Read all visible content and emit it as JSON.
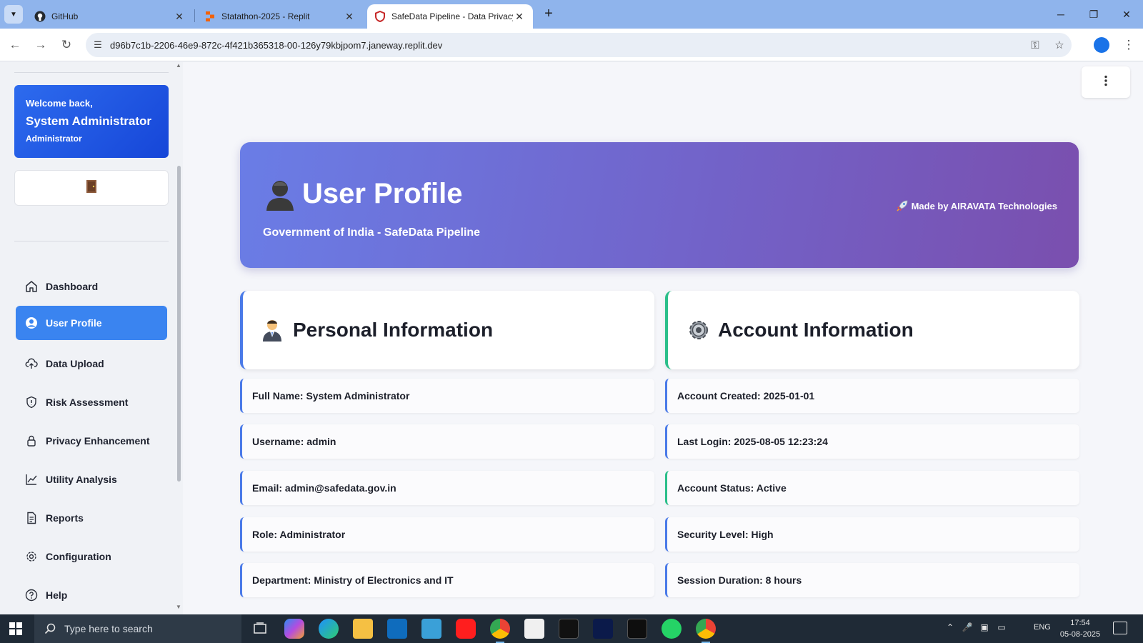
{
  "browser": {
    "tabs": [
      {
        "label": "GitHub",
        "active": false
      },
      {
        "label": "Statathon-2025 - Replit",
        "active": false
      },
      {
        "label": "SafeData Pipeline - Data Privacy",
        "active": true
      }
    ],
    "url": "d96b7c1b-2206-46e9-872c-4f421b365318-00-126y79kbjpom7.janeway.replit.dev"
  },
  "sidebar": {
    "welcome_line": "Welcome back,",
    "user_name": "System Administrator",
    "user_role": "Administrator",
    "logout_icon": "door-icon",
    "items": [
      {
        "label": "Dashboard",
        "icon": "home-icon",
        "active": false
      },
      {
        "label": "User Profile",
        "icon": "user-circle-icon",
        "active": true
      },
      {
        "label": "Data Upload",
        "icon": "cloud-upload-icon",
        "active": false
      },
      {
        "label": "Risk Assessment",
        "icon": "shield-icon",
        "active": false
      },
      {
        "label": "Privacy Enhancement",
        "icon": "lock-icon",
        "active": false
      },
      {
        "label": "Utility Analysis",
        "icon": "line-chart-icon",
        "active": false
      },
      {
        "label": "Reports",
        "icon": "document-icon",
        "active": false
      },
      {
        "label": "Configuration",
        "icon": "gear-icon",
        "active": false
      },
      {
        "label": "Help",
        "icon": "question-icon",
        "active": false
      }
    ]
  },
  "hero": {
    "title": "User Profile",
    "subtitle": "Government of India - SafeData Pipeline",
    "made_by": "Made by AIRAVATA Technologies"
  },
  "personal": {
    "title": "Personal Information",
    "rows": [
      "Full Name: System Administrator",
      "Username: admin",
      "Email: admin@safedata.gov.in",
      "Role: Administrator",
      "Department: Ministry of Electronics and IT"
    ]
  },
  "account": {
    "title": "Account Information",
    "rows": [
      "Account Created: 2025-01-01",
      "Last Login: 2025-08-05 12:23:24",
      "Account Status: Active",
      "Security Level: High",
      "Session Duration: 8 hours"
    ]
  },
  "taskbar": {
    "search_placeholder": "Type here to search",
    "language": "ENG",
    "time": "17:54",
    "date": "05-08-2025"
  },
  "colors": {
    "accent_blue": "#3a84f0",
    "hero_gradient_start": "#6a7de6",
    "hero_gradient_end": "#7a4fae",
    "status_green": "#2bbf8a"
  }
}
